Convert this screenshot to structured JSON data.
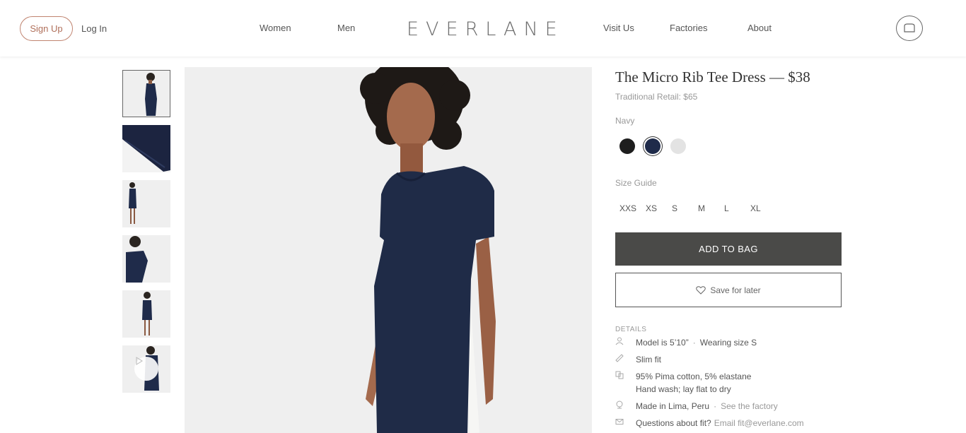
{
  "header": {
    "signup_label": "Sign Up",
    "login_label": "Log In",
    "nav_women": "Women",
    "nav_men": "Men",
    "logo": "EVERLANE",
    "nav_visit": "Visit Us",
    "nav_factories": "Factories",
    "nav_about": "About",
    "bag_icon": "bag-icon"
  },
  "thumbnails": [
    {
      "alt": "front-full",
      "active": true
    },
    {
      "alt": "fabric-detail"
    },
    {
      "alt": "full-length"
    },
    {
      "alt": "upper-body"
    },
    {
      "alt": "back-view"
    },
    {
      "alt": "video"
    }
  ],
  "product": {
    "title": "The Micro Rib Tee Dress — $38",
    "retail": "Traditional Retail: $65",
    "color_name": "Navy",
    "colors": [
      {
        "name": "Black",
        "hex": "#1e1e1e"
      },
      {
        "name": "Navy",
        "hex": "#1f2b4a",
        "selected": true
      },
      {
        "name": "Light Grey",
        "hex": "#e3e3e3"
      }
    ],
    "size_guide": "Size Guide",
    "sizes": [
      "XXS",
      "XS",
      "S",
      "M",
      "L",
      "XL"
    ],
    "add_to_bag": "ADD TO BAG",
    "save_for_later": "Save for later"
  },
  "details": {
    "heading": "DETAILS",
    "model": "Model is 5’10”",
    "wearing": "Wearing size S",
    "fit": "Slim fit",
    "fabric": "95% Pima cotton, 5% elastane",
    "care": "Hand wash; lay flat to dry",
    "made": "Made in Lima, Peru",
    "factory_link": "See the factory",
    "questions": "Questions about fit?",
    "email": "Email fit@everlane.com"
  }
}
